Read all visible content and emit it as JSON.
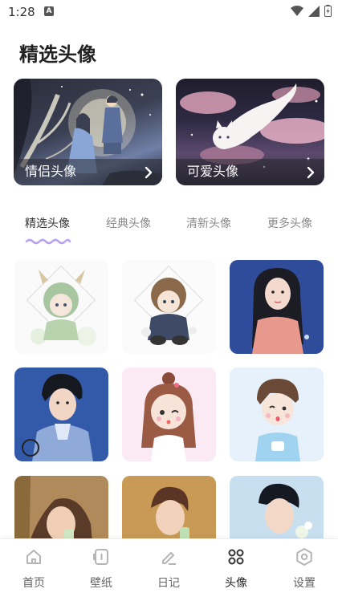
{
  "status": {
    "time": "1:28",
    "a_badge": "A"
  },
  "page": {
    "title": "精选头像"
  },
  "cards": [
    {
      "label": "情侣头像",
      "icon": "chevron-right-icon"
    },
    {
      "label": "可爱头像",
      "icon": "chevron-right-icon"
    }
  ],
  "tabs": [
    {
      "label": "精选头像",
      "active": true
    },
    {
      "label": "经典头像",
      "active": false
    },
    {
      "label": "清新头像",
      "active": false
    },
    {
      "label": "更多头像",
      "active": false
    }
  ],
  "colors": {
    "accent": "#b9a3ef",
    "active_text": "#333333",
    "inactive_text": "#8a8a8a"
  },
  "nav": [
    {
      "label": "首页",
      "icon": "home-icon",
      "active": false
    },
    {
      "label": "壁纸",
      "icon": "wallpaper-icon",
      "active": false
    },
    {
      "label": "日记",
      "icon": "edit-icon",
      "active": false
    },
    {
      "label": "头像",
      "icon": "grid-icon",
      "active": true
    },
    {
      "label": "设置",
      "icon": "settings-icon",
      "active": false
    }
  ]
}
